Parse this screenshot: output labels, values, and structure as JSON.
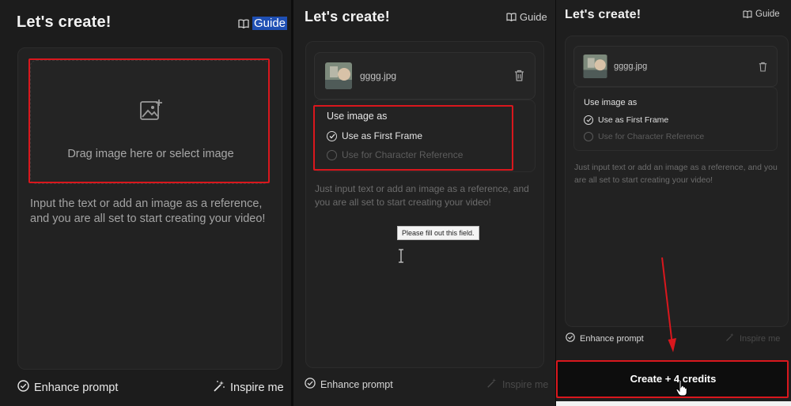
{
  "panel1": {
    "title": "Let's create!",
    "guide_label": "Guide",
    "upload_hint": "Drag image here or select image",
    "description": "Input the text or add an image as a reference, and you are all set to start creating your video!",
    "enhance_label": "Enhance prompt",
    "inspire_label": "Inspire me"
  },
  "panel2": {
    "title": "Let's create!",
    "guide_label": "Guide",
    "filename": "gggg.jpg",
    "use_image_as": "Use image as",
    "options": [
      {
        "label": "Use as First Frame",
        "selected": true
      },
      {
        "label": "Use for Character Reference",
        "selected": false
      }
    ],
    "description": "Just input text or add an image as a reference, and you are all set to start creating your video!",
    "tooltip": "Please fill out this field.",
    "enhance_label": "Enhance prompt",
    "inspire_label": "Inspire me"
  },
  "panel3": {
    "title": "Let's create!",
    "guide_label": "Guide",
    "filename": "gggg.jpg",
    "use_image_as": "Use image as",
    "options": [
      {
        "label": "Use as First Frame",
        "selected": true
      },
      {
        "label": "Use for Character Reference",
        "selected": false
      }
    ],
    "description": "Just input text or add an image as a reference, and you are all set to start creating your video!",
    "enhance_label": "Enhance prompt",
    "inspire_label": "Inspire me",
    "create_label": "Create + 4 credits"
  },
  "colors": {
    "annotation_red": "#d9171d",
    "panel_bg": "#1c1c1c",
    "text_primary": "#e6e6e6"
  }
}
